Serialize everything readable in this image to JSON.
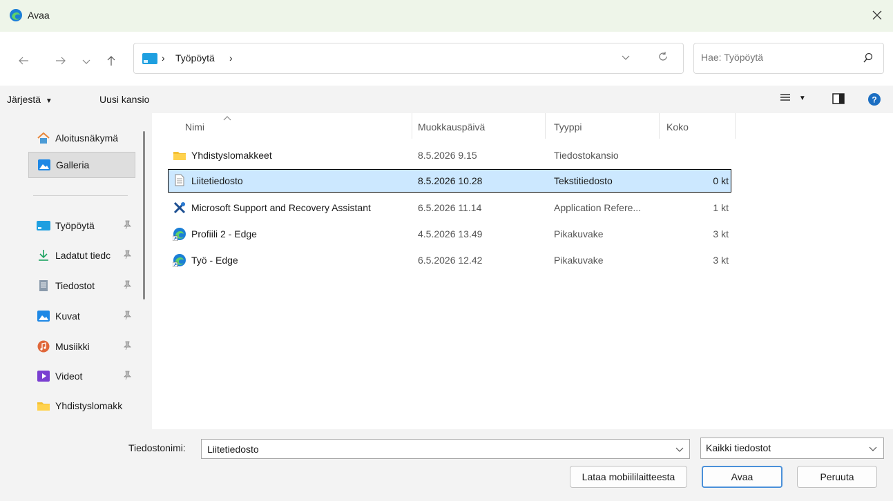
{
  "window": {
    "title": "Avaa"
  },
  "address": {
    "crumbs": [
      "Työpöytä"
    ],
    "separator": "›"
  },
  "search": {
    "placeholder": "Hae: Työpöytä"
  },
  "commands": {
    "organize": "Järjestä",
    "new_folder": "Uusi kansio"
  },
  "sidebar": {
    "items": [
      {
        "label": "Aloitusnäkymä",
        "icon": "home-icon"
      },
      {
        "label": "Galleria",
        "icon": "gallery-icon"
      },
      {
        "label": "Työpöytä",
        "icon": "desktop-icon"
      },
      {
        "label": "Ladatut tiedc",
        "icon": "download-icon"
      },
      {
        "label": "Tiedostot",
        "icon": "document-icon"
      },
      {
        "label": "Kuvat",
        "icon": "pictures-icon"
      },
      {
        "label": "Musiikki",
        "icon": "music-icon"
      },
      {
        "label": "Videot",
        "icon": "videos-icon"
      },
      {
        "label": "Yhdistyslomakk",
        "icon": "folder-icon"
      }
    ]
  },
  "columns": {
    "name": "Nimi",
    "modified": "Muokkauspäivä",
    "type": "Tyyppi",
    "size": "Koko"
  },
  "files": [
    {
      "name": "Yhdistyslomakkeet",
      "modified": "8.5.2026 9.15",
      "type": "Tiedostokansio",
      "size": "",
      "icon": "folder-icon"
    },
    {
      "name": "Liitetiedosto",
      "modified": "8.5.2026 10.28",
      "type": "Tekstitiedosto",
      "size": "0 kt",
      "icon": "text-file-icon"
    },
    {
      "name": "Microsoft Support and Recovery Assistant",
      "modified": "6.5.2026 11.14",
      "type": "Application Refere...",
      "size": "1 kt",
      "icon": "support-tool-icon"
    },
    {
      "name": "Profiili 2 - Edge",
      "modified": "4.5.2026 13.49",
      "type": "Pikakuvake",
      "size": "3 kt",
      "icon": "edge-shortcut-icon"
    },
    {
      "name": "Työ - Edge",
      "modified": "6.5.2026 12.42",
      "type": "Pikakuvake",
      "size": "3 kt",
      "icon": "edge-shortcut-icon"
    }
  ],
  "bottom": {
    "filename_label": "Tiedostonimi:",
    "filename_value": "Liitetiedosto",
    "filetype_value": "Kaikki tiedostot",
    "mobile_button": "Lataa mobiililaitteesta",
    "open_button": "Avaa",
    "cancel_button": "Peruuta"
  },
  "colors": {
    "accent": "#0067c0",
    "selection": "#cce8ff",
    "titlebar": "#eef5e9"
  }
}
